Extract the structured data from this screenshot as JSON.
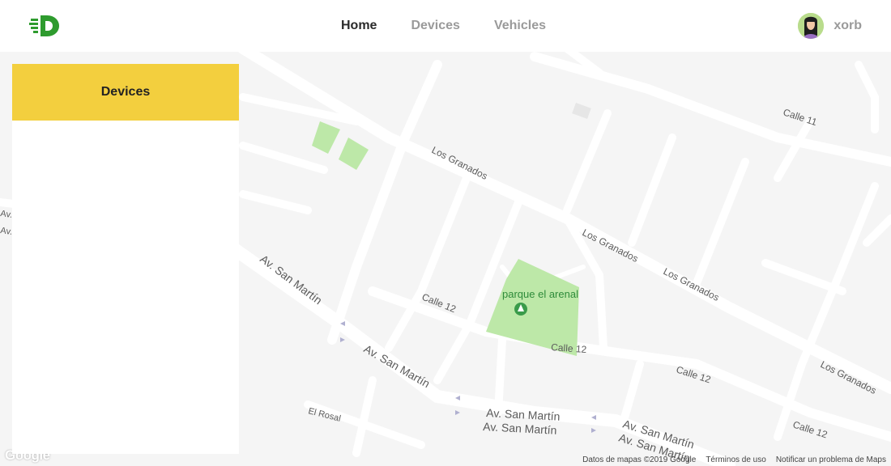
{
  "header": {
    "nav": [
      {
        "label": "Home",
        "active": true
      },
      {
        "label": "Devices",
        "active": false
      },
      {
        "label": "Vehicles",
        "active": false
      }
    ],
    "user": {
      "name": "xorb",
      "avatar_icon": "user-avatar-icon"
    },
    "logo_icon": "brand-logo-icon",
    "brand_color": "#2e9b2e"
  },
  "panel": {
    "title": "Devices",
    "header_color": "#f3cf3e"
  },
  "map": {
    "streets": {
      "los_granados_1": "Los Granados",
      "los_granados_2": "Los Granados",
      "los_granados_3": "Los Granados",
      "los_granados_4": "Los Granados",
      "calle_11": "Calle 11",
      "calle_12_a": "Calle 12",
      "calle_12_b": "Calle 12",
      "calle_12_c": "Calle 12",
      "calle_12_d": "Calle 12",
      "san_martin_a": "Av. San Martín",
      "san_martin_b": "Av. San Martín",
      "san_martin_c": "Av. San Martín",
      "san_martin_d": "Av. San Martín",
      "san_martin_e": "Av. San Martín",
      "san_martin_f": "Av. San Martín",
      "el_rosal": "El Rosal",
      "av_left_1": "Av.",
      "av_left_2": "Av."
    },
    "park_label": "parque el arenal",
    "park_color": "#bde8a8",
    "google_logo": "Google",
    "footer": {
      "data": "Datos de mapas ©2019 Google",
      "terms": "Términos de uso",
      "report": "Notificar un problema de Maps"
    }
  }
}
